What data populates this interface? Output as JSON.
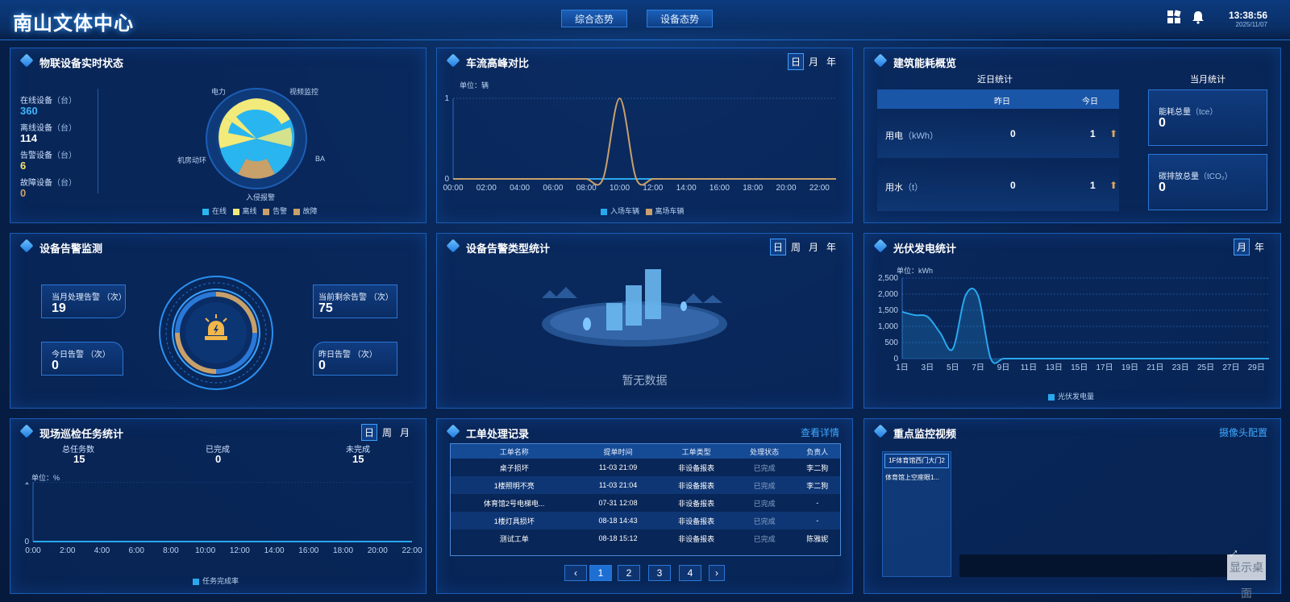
{
  "header": {
    "title": "南山文体中心",
    "tabs": [
      "综合态势",
      "设备态势"
    ],
    "time": "13:38:56",
    "date": "2025/11/07"
  },
  "iot": {
    "title": "物联设备实时状态",
    "stats": [
      {
        "label": "在线设备",
        "unit": "（台）",
        "value": "360",
        "color": "#3fb6ff"
      },
      {
        "label": "离线设备",
        "unit": "（台）",
        "value": "114",
        "color": "#ffffff"
      },
      {
        "label": "告警设备",
        "unit": "（台）",
        "value": "6",
        "color": "#f3e36b"
      },
      {
        "label": "故障设备",
        "unit": "（台）",
        "value": "0",
        "color": "#c9a36a"
      }
    ],
    "radar_labels": [
      "电力",
      "视频监控",
      "BA",
      "入侵报警",
      "机房动环"
    ],
    "legend": [
      {
        "label": "在线",
        "color": "#29b6f0"
      },
      {
        "label": "离线",
        "color": "#f2ea7a"
      },
      {
        "label": "告警",
        "color": "#c8a06a"
      },
      {
        "label": "故障",
        "color": "#c8a06a"
      }
    ]
  },
  "traffic": {
    "title": "车流高峰对比",
    "periods": [
      "日",
      "月",
      "年"
    ],
    "unit": "单位：辆",
    "legend": [
      {
        "label": "入场车辆",
        "color": "#29a8ee"
      },
      {
        "label": "离场车辆",
        "color": "#c8a06a"
      }
    ]
  },
  "energy": {
    "title": "建筑能耗概览",
    "recent_title": "近日统计",
    "month_title": "当月统计",
    "col_headers": [
      "昨日",
      "今日"
    ],
    "rows": [
      {
        "name": "用电",
        "unit": "（kWh）",
        "yesterday": "0",
        "today": "1"
      },
      {
        "name": "用水",
        "unit": "（t）",
        "yesterday": "0",
        "today": "1"
      }
    ],
    "month_cards": [
      {
        "label": "能耗总量",
        "unit": "（tce）",
        "value": "0"
      },
      {
        "label": "碳排放总量",
        "unit": "（tCO₂）",
        "value": "0"
      }
    ]
  },
  "alarm": {
    "title": "设备告警监测",
    "cards": [
      {
        "label": "当月处理告警 （次）",
        "value": "19"
      },
      {
        "label": "当前剩余告警 （次）",
        "value": "75"
      },
      {
        "label": "今日告警 （次）",
        "value": "0"
      },
      {
        "label": "昨日告警 （次）",
        "value": "0"
      }
    ]
  },
  "alarm_type": {
    "title": "设备告警类型统计",
    "periods": [
      "日",
      "周",
      "月",
      "年"
    ],
    "empty": "暂无数据"
  },
  "pv": {
    "title": "光伏发电统计",
    "periods": [
      "月",
      "年"
    ],
    "unit": "单位：kWh",
    "legend": "光伏发电量"
  },
  "patrol": {
    "title": "现场巡检任务统计",
    "periods": [
      "日",
      "周",
      "月"
    ],
    "stats": [
      {
        "label": "总任务数",
        "value": "15"
      },
      {
        "label": "已完成",
        "value": "0"
      },
      {
        "label": "未完成",
        "value": "15"
      }
    ],
    "unit": "单位：%",
    "legend": "任务完成率"
  },
  "orders": {
    "title": "工单处理记录",
    "link": "查看详情",
    "columns": [
      "工单名称",
      "提单时间",
      "工单类型",
      "处理状态",
      "负责人"
    ],
    "rows": [
      [
        "桌子损坏",
        "11-03 21:09",
        "非设备报表",
        "已完成",
        "李二狗"
      ],
      [
        "1楼照明不亮",
        "11-03 21:04",
        "非设备报表",
        "已完成",
        "李二狗"
      ],
      [
        "体育馆2号电梯电...",
        "07-31 12:08",
        "非设备报表",
        "已完成",
        "-"
      ],
      [
        "1楼灯具损坏",
        "08-18 14:43",
        "非设备报表",
        "已完成",
        "-"
      ],
      [
        "测试工单",
        "08-18 15:12",
        "非设备报表",
        "已完成",
        "陈雅妮"
      ]
    ],
    "pages": [
      "1",
      "2",
      "3",
      "4"
    ]
  },
  "video": {
    "title": "重点监控视频",
    "link": "摄像头配置",
    "cameras": [
      "1F体育馆西门大门2",
      "体育馆上空座眼1..."
    ],
    "overlay": "显示桌面"
  },
  "chart_data": [
    {
      "type": "line",
      "title": "车流高峰对比",
      "ylabel": "单位：辆",
      "x": [
        "00:00",
        "01:00",
        "02:00",
        "03:00",
        "04:00",
        "05:00",
        "06:00",
        "07:00",
        "08:00",
        "09:00",
        "10:00",
        "11:00",
        "12:00",
        "13:00",
        "14:00",
        "15:00",
        "16:00",
        "17:00",
        "18:00",
        "19:00",
        "20:00",
        "21:00",
        "22:00",
        "23:00"
      ],
      "series": [
        {
          "name": "入场车辆",
          "values": [
            0,
            0,
            0,
            0,
            0,
            0,
            0,
            0,
            0,
            0,
            0,
            0,
            0,
            0,
            0,
            0,
            0,
            0,
            0,
            0,
            0,
            0,
            0,
            0
          ]
        },
        {
          "name": "离场车辆",
          "values": [
            0,
            0,
            0,
            0,
            0,
            0,
            0,
            0,
            0,
            0,
            1,
            0,
            0,
            0,
            0,
            0,
            0,
            0,
            0,
            0,
            0,
            0,
            0,
            0
          ]
        }
      ],
      "ylim": [
        0,
        1
      ],
      "yticks": [
        0,
        1
      ],
      "xticks": [
        "00:00",
        "02:00",
        "04:00",
        "06:00",
        "08:00",
        "10:00",
        "12:00",
        "14:00",
        "16:00",
        "18:00",
        "20:00",
        "22:00"
      ]
    },
    {
      "type": "area",
      "title": "光伏发电统计",
      "ylabel": "单位：kWh",
      "x": [
        "1日",
        "2日",
        "3日",
        "4日",
        "5日",
        "6日",
        "7日",
        "8日",
        "9日",
        "10日",
        "11日",
        "12日",
        "13日",
        "14日",
        "15日",
        "16日",
        "17日",
        "18日",
        "19日",
        "20日",
        "21日",
        "22日",
        "23日",
        "24日",
        "25日",
        "26日",
        "27日",
        "28日",
        "29日",
        "30日"
      ],
      "series": [
        {
          "name": "光伏发电量",
          "values": [
            1450,
            1350,
            1300,
            800,
            300,
            1950,
            1950,
            0,
            0,
            0,
            0,
            0,
            0,
            0,
            0,
            0,
            0,
            0,
            0,
            0,
            0,
            0,
            0,
            0,
            0,
            0,
            0,
            0,
            0,
            0
          ]
        }
      ],
      "ylim": [
        0,
        2500
      ],
      "yticks": [
        "0",
        "500",
        "1,000",
        "1,500",
        "2,000",
        "2,500"
      ],
      "xticks": [
        "1日",
        "3日",
        "5日",
        "7日",
        "9日",
        "11日",
        "13日",
        "15日",
        "17日",
        "19日",
        "21日",
        "23日",
        "25日",
        "27日",
        "29日"
      ]
    },
    {
      "type": "line",
      "title": "现场巡检任务统计",
      "ylabel": "单位：%",
      "x": [
        "00:00",
        "02:00",
        "04:00",
        "06:00",
        "08:00",
        "10:00",
        "12:00",
        "14:00",
        "16:00",
        "18:00",
        "20:00",
        "22:00"
      ],
      "series": [
        {
          "name": "任务完成率",
          "values": [
            0,
            0,
            0,
            0,
            0,
            0,
            0,
            0,
            0,
            0,
            0,
            0
          ]
        }
      ],
      "ylim": [
        0,
        1
      ],
      "yticks": [
        0,
        1
      ],
      "xticks": [
        "0:00",
        "2:00",
        "4:00",
        "6:00",
        "8:00",
        "10:00",
        "12:00",
        "14:00",
        "16:00",
        "18:00",
        "20:00",
        "22:00"
      ]
    }
  ]
}
